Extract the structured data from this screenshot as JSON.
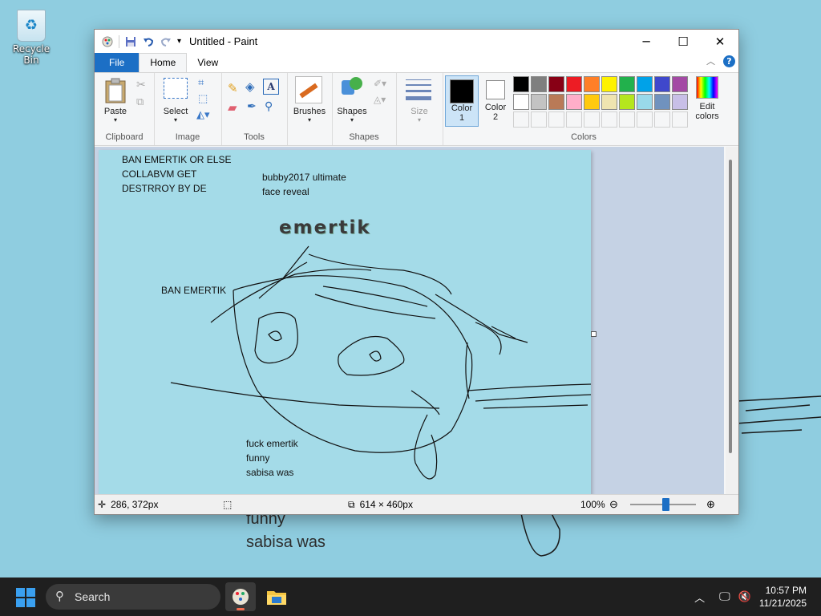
{
  "desktop": {
    "recycle_bin_label": "Recycle Bin",
    "background_text": [
      "funny",
      "sabisa was"
    ]
  },
  "window": {
    "title": "Untitled - Paint",
    "tabs": [
      "File",
      "Home",
      "View"
    ],
    "active_tab": "Home"
  },
  "ribbon": {
    "clipboard": {
      "group": "Clipboard",
      "paste": "Paste"
    },
    "image": {
      "group": "Image",
      "select": "Select"
    },
    "tools": {
      "group": "Tools"
    },
    "brushes": "Brushes",
    "shapes": {
      "group": "Shapes",
      "shapes": "Shapes"
    },
    "size": "Size",
    "colors": {
      "group": "Colors",
      "color1": "Color\n1",
      "color2": "Color\n2",
      "edit": "Edit\ncolors",
      "color1_value": "#000000",
      "color2_value": "#ffffff",
      "palette_row1": [
        "#000000",
        "#7f7f7f",
        "#880015",
        "#ed1c24",
        "#ff7f27",
        "#fff200",
        "#22b14c",
        "#00a2e8",
        "#3f48cc",
        "#a349a4"
      ],
      "palette_row2": [
        "#ffffff",
        "#c3c3c3",
        "#b97a57",
        "#ffaec9",
        "#ffc90e",
        "#efe4b0",
        "#b5e61d",
        "#99d9ea",
        "#7092be",
        "#c8bfe7"
      ]
    }
  },
  "canvas": {
    "background": "#a4dbe8",
    "texts": {
      "ban_block": "BAN EMERTIK OR ELSE\nCOLLABVM GET\nDESTRROY BY DE",
      "bubby": "bubby2017 ultimate\nface reveal",
      "emertik": "emertik",
      "ban_emertik": "BAN EMERTIK",
      "bottom": "fuck emertik\nfunny\nsabisa was"
    }
  },
  "status": {
    "cursor_pos": "286, 372px",
    "image_size": "614 × 460px",
    "zoom": "100%"
  },
  "taskbar": {
    "search": "Search",
    "time": "10:57 PM",
    "date": "11/21/2025"
  }
}
